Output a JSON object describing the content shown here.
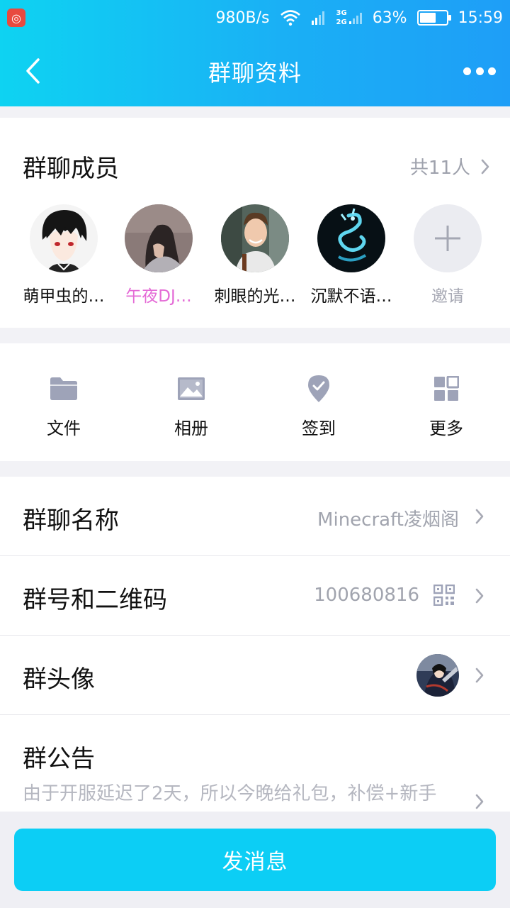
{
  "status_bar": {
    "net_speed": "980B/s",
    "net_3g": "3G",
    "net_2g": "2G",
    "battery": "63%",
    "battery_level": 0.63,
    "time": "15:59"
  },
  "nav": {
    "title": "群聊资料"
  },
  "members": {
    "title": "群聊成员",
    "count": "共11人",
    "items": [
      {
        "name": "萌甲虫的…",
        "avatar": "anime-boy"
      },
      {
        "name": "午夜DJ…",
        "avatar": "girl-photo"
      },
      {
        "name": "刺眼的光…",
        "avatar": "young-man"
      },
      {
        "name": "沉默不语…",
        "avatar": "blue-dragon"
      }
    ],
    "invite_label": "邀请"
  },
  "tools": [
    {
      "label": "文件",
      "icon": "folder-icon"
    },
    {
      "label": "相册",
      "icon": "image-icon"
    },
    {
      "label": "签到",
      "icon": "checkin-pin-icon"
    },
    {
      "label": "更多",
      "icon": "grid-icon"
    }
  ],
  "info": {
    "name_label": "群聊名称",
    "name_value": "Minecraft凌烟阁",
    "id_label": "群号和二维码",
    "id_value": "100680816",
    "avatar_label": "群头像",
    "notice_label": "群公告",
    "notice_text": "由于开服延迟了2天，所以今晚给礼包，补偿+新手"
  },
  "bottom": {
    "send_label": "发消息"
  },
  "colors": {
    "header_start": "#0ed3f2",
    "header_end": "#1e9ef7",
    "accent": "#0ccef5",
    "pink_name": "#e46bd6"
  }
}
